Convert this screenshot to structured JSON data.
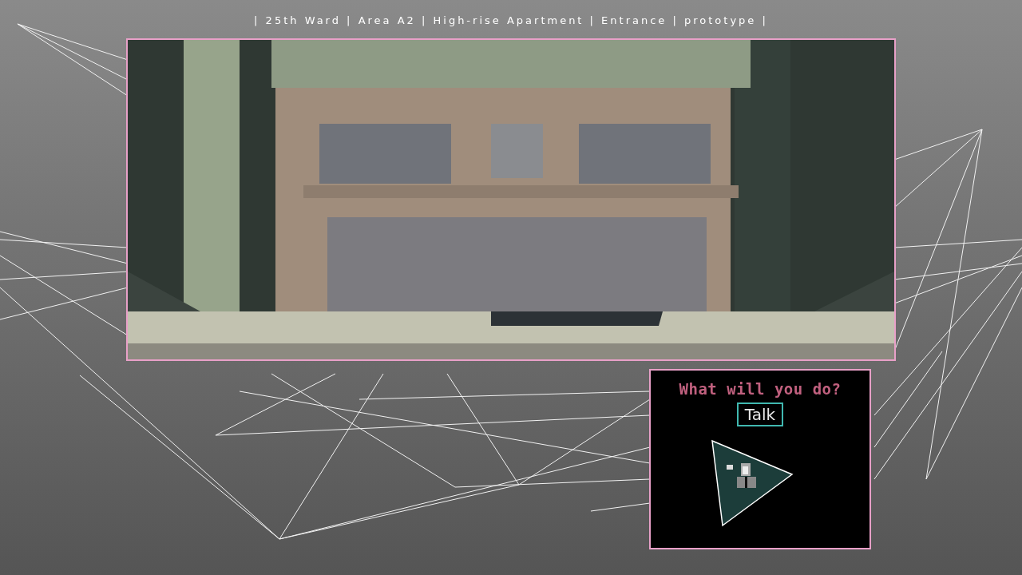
{
  "location_bar": "| 25th Ward | Area A2 | High-rise Apartment | Entrance | prototype |",
  "action_panel": {
    "prompt": "What will you do?",
    "options": [
      {
        "label": "Talk",
        "selected": true
      }
    ]
  }
}
